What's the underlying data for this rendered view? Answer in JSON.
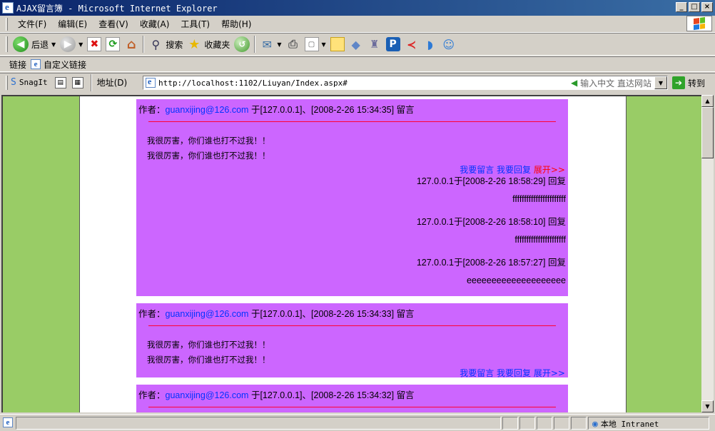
{
  "window": {
    "title": "AJAX留言簿 - Microsoft Internet Explorer"
  },
  "menu": {
    "items": [
      "文件(F)",
      "编辑(E)",
      "查看(V)",
      "收藏(A)",
      "工具(T)",
      "帮助(H)"
    ]
  },
  "toolbar": {
    "back_label": "后退",
    "search_label": "搜索",
    "favorites_label": "收藏夹"
  },
  "links": {
    "label": "链接",
    "custom_label": "自定义链接"
  },
  "address": {
    "snagit_label": "SnagIt",
    "label": "地址(D)",
    "url": "http://localhost:1102/Liuyan/Index.aspx#",
    "hint": "输入中文 直达网站",
    "go_label": "转到"
  },
  "messages": [
    {
      "author_prefix": "作者：",
      "author_email": "guanxijing@126.com",
      "meta": "于[127.0.0.1]、[2008-2-26 15:34:35] 留言",
      "lines": [
        "我很厉害，你们谁也打不过我！！",
        "我很厉害，你们谁也打不过我！！"
      ],
      "action_leave": "我要留言",
      "action_reply": "我要回复",
      "action_expand": "展开>>",
      "replies": [
        {
          "meta": "127.0.0.1于[2008-2-26 18:58:29] 回复",
          "text": "fffffffffffffffffffffff"
        },
        {
          "meta": "127.0.0.1于[2008-2-26 18:58:10] 回复",
          "text": "ffffffffffffffffffffff"
        },
        {
          "meta": "127.0.0.1于[2008-2-26 18:57:27] 回复",
          "text": "eeeeeeeeeeeeeeeeeeee"
        }
      ]
    },
    {
      "author_prefix": "作者：",
      "author_email": "guanxijing@126.com",
      "meta": "于[127.0.0.1]、[2008-2-26 15:34:33] 留言",
      "lines": [
        "我很厉害，你们谁也打不过我！！",
        "我很厉害，你们谁也打不过我！！"
      ],
      "action_leave": "我要留言",
      "action_reply": "我要回复",
      "action_expand": "展开>>"
    },
    {
      "author_prefix": "作者：",
      "author_email": "guanxijing@126.com",
      "meta": "于[127.0.0.1]、[2008-2-26 15:34:32] 留言"
    }
  ],
  "status": {
    "zone": "本地 Intranet"
  }
}
